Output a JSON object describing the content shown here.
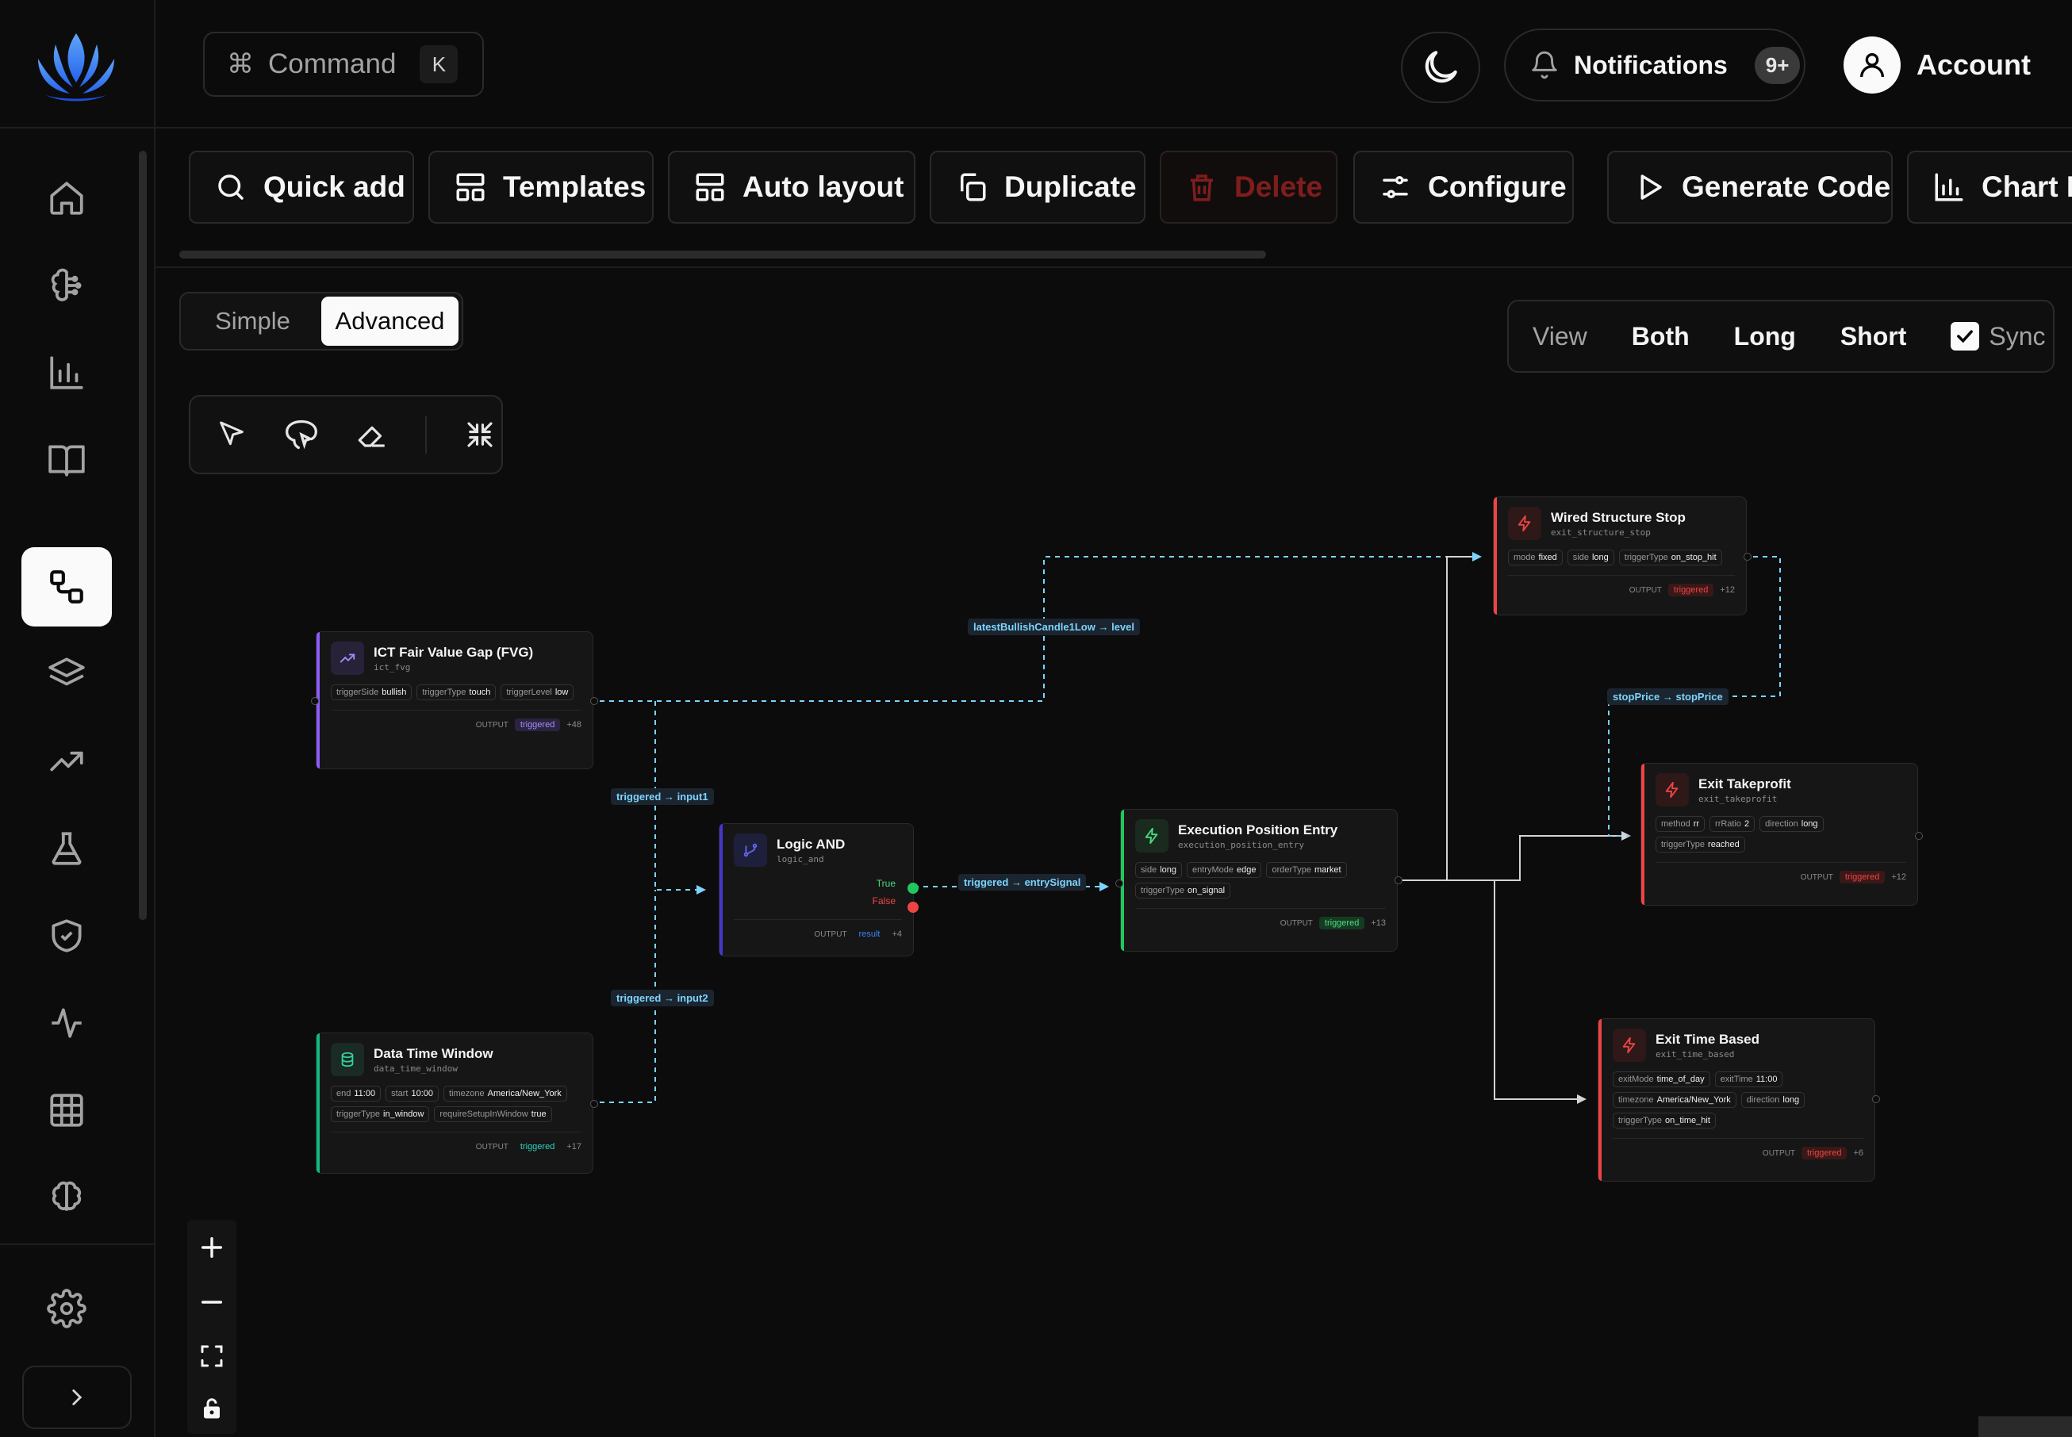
{
  "header": {
    "command_label": "Command",
    "command_key": "K",
    "notifications_label": "Notifications",
    "notifications_count": "9+",
    "account_label": "Account"
  },
  "toolbar": {
    "quick_add": "Quick add",
    "templates": "Templates",
    "auto_layout": "Auto layout",
    "duplicate": "Duplicate",
    "delete": "Delete",
    "configure": "Configure",
    "generate_code": "Generate Code",
    "chart_export": "Chart E"
  },
  "mode": {
    "simple": "Simple",
    "advanced": "Advanced",
    "active": "Advanced"
  },
  "view_filter": {
    "label": "View",
    "both": "Both",
    "long": "Long",
    "short": "Short",
    "sync": "Sync"
  },
  "edge_labels": {
    "fvg_to_stop": "latestBullishCandle1Low → level",
    "fvg_to_and": "triggered → input1",
    "time_to_and": "triggered → input2",
    "and_to_entry": "triggered → entrySignal",
    "stop_to_tp": "stopPrice → stopPrice"
  },
  "nodes": {
    "fvg": {
      "title": "ICT Fair Value Gap (FVG)",
      "id": "ict_fvg",
      "params": [
        [
          "triggerSide",
          "bullish"
        ],
        [
          "triggerType",
          "touch"
        ],
        [
          "triggerLevel",
          "low"
        ]
      ],
      "output_label": "OUTPUT",
      "output": "triggered",
      "extra": "+48"
    },
    "logic_and": {
      "title": "Logic AND",
      "id": "logic_and",
      "true_label": "True",
      "false_label": "False",
      "output_label": "OUTPUT",
      "output": "result",
      "extra": "+4"
    },
    "time_window": {
      "title": "Data Time Window",
      "id": "data_time_window",
      "params": [
        [
          "end",
          "11:00"
        ],
        [
          "start",
          "10:00"
        ],
        [
          "timezone",
          "America/New_York"
        ],
        [
          "triggerType",
          "in_window"
        ],
        [
          "requireSetupInWindow",
          "true"
        ]
      ],
      "output_label": "OUTPUT",
      "output": "triggered",
      "extra": "+17"
    },
    "entry": {
      "title": "Execution Position Entry",
      "id": "execution_position_entry",
      "params": [
        [
          "side",
          "long"
        ],
        [
          "entryMode",
          "edge"
        ],
        [
          "orderType",
          "market"
        ],
        [
          "triggerType",
          "on_signal"
        ]
      ],
      "output_label": "OUTPUT",
      "output": "triggered",
      "extra": "+13"
    },
    "stop": {
      "title": "Wired Structure Stop",
      "id": "exit_structure_stop",
      "params": [
        [
          "mode",
          "fixed"
        ],
        [
          "side",
          "long"
        ],
        [
          "triggerType",
          "on_stop_hit"
        ]
      ],
      "output_label": "OUTPUT",
      "output": "triggered",
      "extra": "+12"
    },
    "takeprofit": {
      "title": "Exit Takeprofit",
      "id": "exit_takeprofit",
      "params": [
        [
          "method",
          "rr"
        ],
        [
          "rrRatio",
          "2"
        ],
        [
          "direction",
          "long"
        ],
        [
          "triggerType",
          "reached"
        ]
      ],
      "output_label": "OUTPUT",
      "output": "triggered",
      "extra": "+12"
    },
    "timebased": {
      "title": "Exit Time Based",
      "id": "exit_time_based",
      "params": [
        [
          "exitMode",
          "time_of_day"
        ],
        [
          "exitTime",
          "11:00"
        ],
        [
          "timezone",
          "America/New_York"
        ],
        [
          "direction",
          "long"
        ],
        [
          "triggerType",
          "on_time_hit"
        ]
      ],
      "output_label": "OUTPUT",
      "output": "triggered",
      "extra": "+6"
    }
  },
  "colors": {
    "fvg": "#8b5cf6",
    "logic": "#4338ca",
    "time": "#10b981",
    "entry": "#22c55e",
    "exit": "#ef4444",
    "edge": "#7dd3fc"
  },
  "icons": {
    "nav": [
      "home-icon",
      "brain-icon",
      "bar-chart-icon",
      "book-icon",
      "workflow-icon",
      "layers-icon",
      "trending-up-icon",
      "flask-icon",
      "shield-check-icon",
      "activity-icon",
      "grid-icon",
      "brain-circuit-icon"
    ],
    "settings": "gear-icon"
  }
}
